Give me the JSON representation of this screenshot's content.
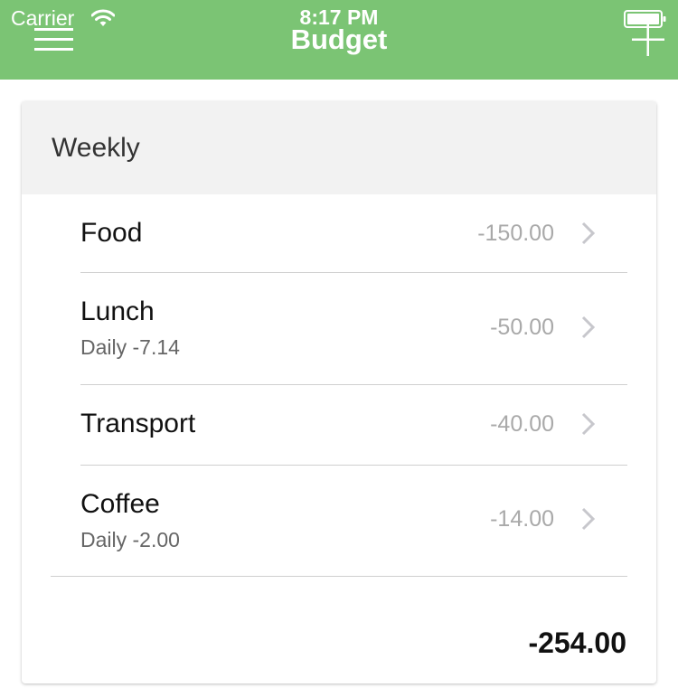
{
  "status_bar": {
    "carrier": "Carrier",
    "time": "8:17 PM"
  },
  "nav": {
    "title": "Budget",
    "left_icon": "menu-icon",
    "right_icon": "add-icon"
  },
  "colors": {
    "accent": "#7bc474",
    "header_bg": "#f2f2f2"
  },
  "budget": {
    "period": "Weekly",
    "items": [
      {
        "name": "Food",
        "subtitle": "",
        "amount": "-150.00"
      },
      {
        "name": "Lunch",
        "subtitle": "Daily -7.14",
        "amount": "-50.00"
      },
      {
        "name": "Transport",
        "subtitle": "",
        "amount": "-40.00"
      },
      {
        "name": "Coffee",
        "subtitle": "Daily -2.00",
        "amount": "-14.00"
      }
    ],
    "total": "-254.00"
  }
}
